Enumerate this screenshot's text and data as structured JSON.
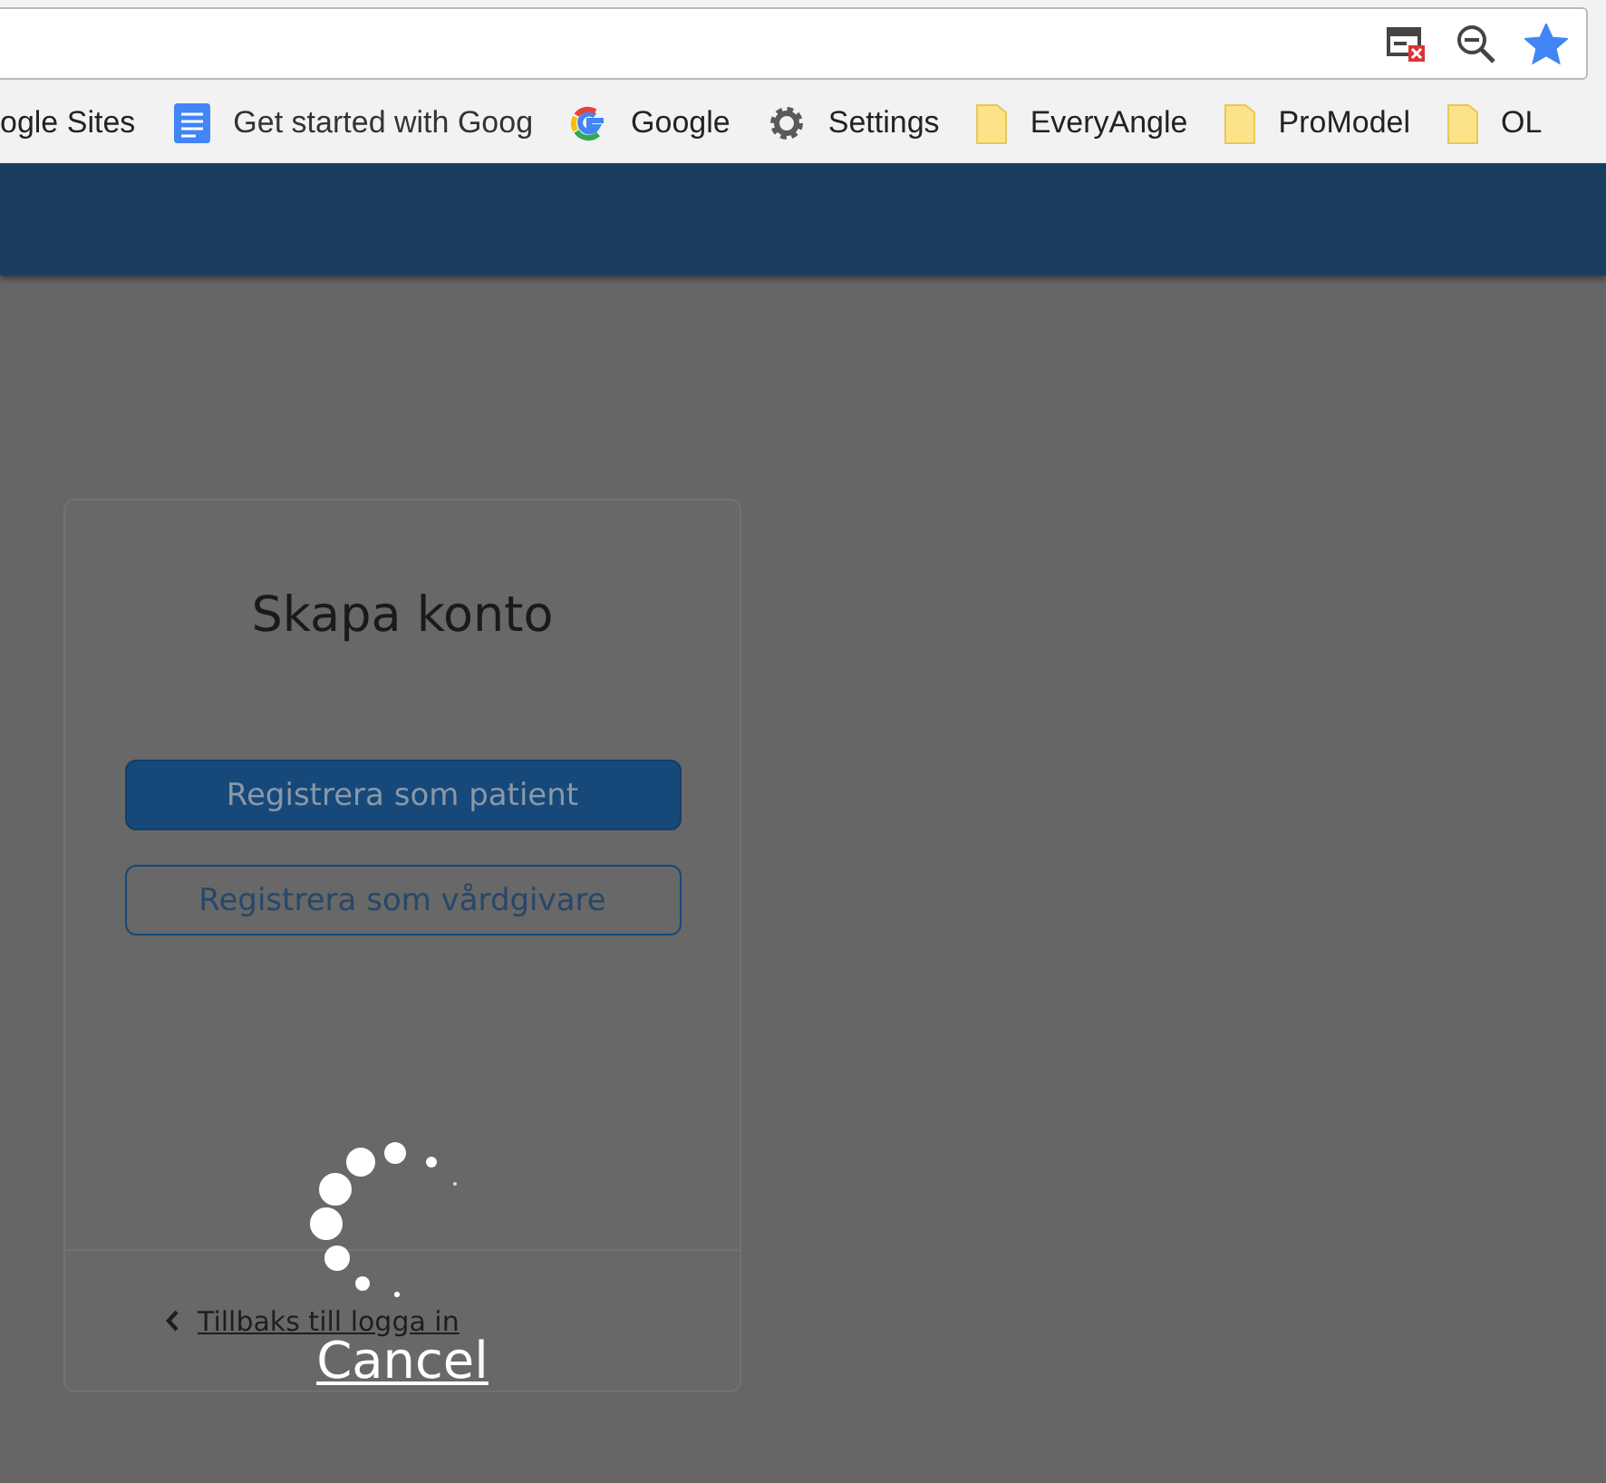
{
  "browser": {
    "bookmarked": true,
    "bookmarks": [
      {
        "kind": "text",
        "label": "ogle Sites"
      },
      {
        "kind": "docs",
        "label": "Get started with Goog"
      },
      {
        "kind": "google",
        "label": "Google"
      },
      {
        "kind": "gear",
        "label": "Settings"
      },
      {
        "kind": "folder",
        "label": "EveryAngle"
      },
      {
        "kind": "folder",
        "label": "ProModel"
      },
      {
        "kind": "folder",
        "label": "OL"
      }
    ]
  },
  "card": {
    "title": "Skapa konto",
    "buttons": [
      {
        "kind": "primary",
        "label": "Registrera som patient"
      },
      {
        "kind": "outline",
        "label": "Registrera som vårdgivare"
      }
    ],
    "back_link": "Tillbaks till logga in"
  },
  "loading": {
    "cancel": "Cancel"
  }
}
